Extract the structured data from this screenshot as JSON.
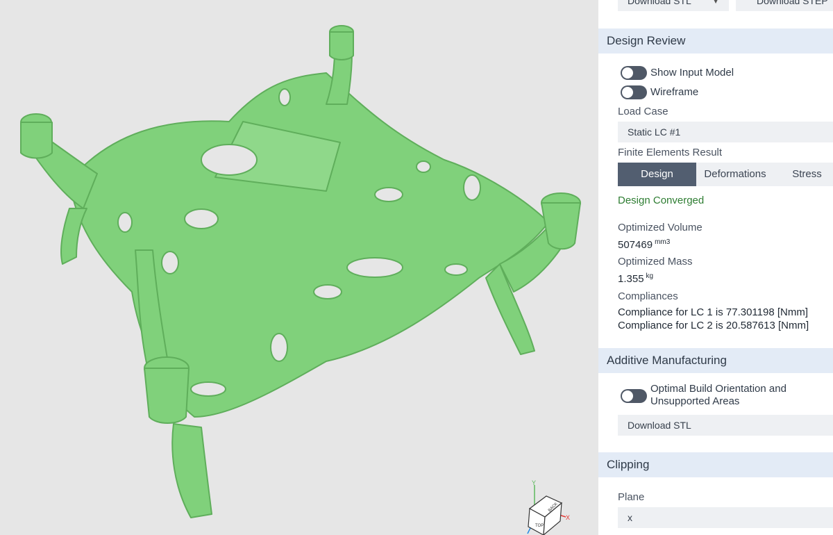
{
  "top_bar": {
    "download_select_value": "Download STL",
    "download_step_label": "Download STEP"
  },
  "design_review": {
    "title": "Design Review",
    "show_input_model_label": "Show Input Model",
    "wireframe_label": "Wireframe",
    "load_case_label": "Load Case",
    "load_case_value": "Static LC #1",
    "fe_result_label": "Finite Elements Result",
    "tabs": [
      {
        "label": "Design",
        "active": true
      },
      {
        "label": "Deformations",
        "active": false
      },
      {
        "label": "Stress",
        "active": false
      }
    ],
    "status": "Design Converged",
    "volume_label": "Optimized Volume",
    "volume_value": "507469",
    "volume_unit": "mm3",
    "mass_label": "Optimized Mass",
    "mass_value": "1.355",
    "mass_unit": "kg",
    "compliances_label": "Compliances",
    "compliances": [
      "Compliance for LC 1 is 77.301198 [Nmm]",
      "Compliance for LC 2 is 20.587613 [Nmm]"
    ]
  },
  "additive": {
    "title": "Additive Manufacturing",
    "orientation_label": "Optimal Build Orientation and Unsupported Areas",
    "download_label": "Download STL"
  },
  "clipping": {
    "title": "Clipping",
    "plane_label": "Plane",
    "plane_value": "x"
  },
  "gizmo": {
    "x_label": "X",
    "y_label": "Y",
    "back_label": "BACK",
    "top_label": "TOP"
  },
  "colors": {
    "model_green": "#7fd07a",
    "panel_header": "#e3ebf6",
    "active_tab": "#525e70",
    "status_green": "#2e7d32"
  }
}
